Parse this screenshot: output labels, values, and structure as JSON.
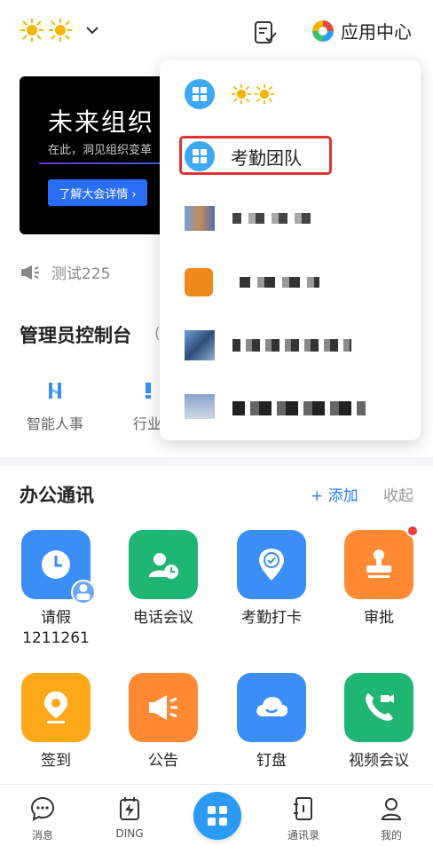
{
  "header": {
    "org_icon": "sun-emoji-pair",
    "app_center_label": "应用中心"
  },
  "banner": {
    "title": "未来组织",
    "subtitle": "在此，洞见组织变革",
    "button": "了解大会详情 ›"
  },
  "announcement": {
    "text": "测试225"
  },
  "admin": {
    "title": "管理员控制台",
    "items": [
      {
        "label": "智能人事",
        "icon": "hr-icon"
      },
      {
        "label": "行业",
        "icon": "industry-icon"
      }
    ]
  },
  "office": {
    "title": "办公通讯",
    "add_label": "+ 添加",
    "collapse_label": "收起",
    "apps": [
      {
        "label": "请假",
        "sublabel": "1211261",
        "icon": "clock-icon",
        "color": "#3a8ef6"
      },
      {
        "label": "电话会议",
        "icon": "phone-conference-icon",
        "color": "#1fb673"
      },
      {
        "label": "考勤打卡",
        "icon": "location-check-icon",
        "color": "#3a8ef6"
      },
      {
        "label": "审批",
        "icon": "stamp-icon",
        "color": "#ff8a33"
      },
      {
        "label": "签到",
        "icon": "pin-icon",
        "color": "#ffa81a"
      },
      {
        "label": "公告",
        "icon": "megaphone-icon",
        "color": "#ff8a33"
      },
      {
        "label": "钉盘",
        "icon": "cloud-icon",
        "color": "#3a8ef6"
      },
      {
        "label": "视频会议",
        "icon": "video-call-icon",
        "color": "#1fb673"
      }
    ]
  },
  "dropdown": {
    "items": [
      {
        "label": "☀☀",
        "icon": "grid-icon"
      },
      {
        "label": "考勤团队",
        "icon": "grid-icon"
      }
    ]
  },
  "tabbar": {
    "tabs": [
      {
        "label": "消息",
        "icon": "chat-icon"
      },
      {
        "label": "DING",
        "icon": "ding-icon"
      },
      {
        "label": "",
        "icon": "workbench-icon"
      },
      {
        "label": "通讯录",
        "icon": "contacts-icon"
      },
      {
        "label": "我的",
        "icon": "profile-icon"
      }
    ]
  },
  "colors": {
    "accent": "#2a7cf7",
    "highlight": "#e0332d"
  }
}
